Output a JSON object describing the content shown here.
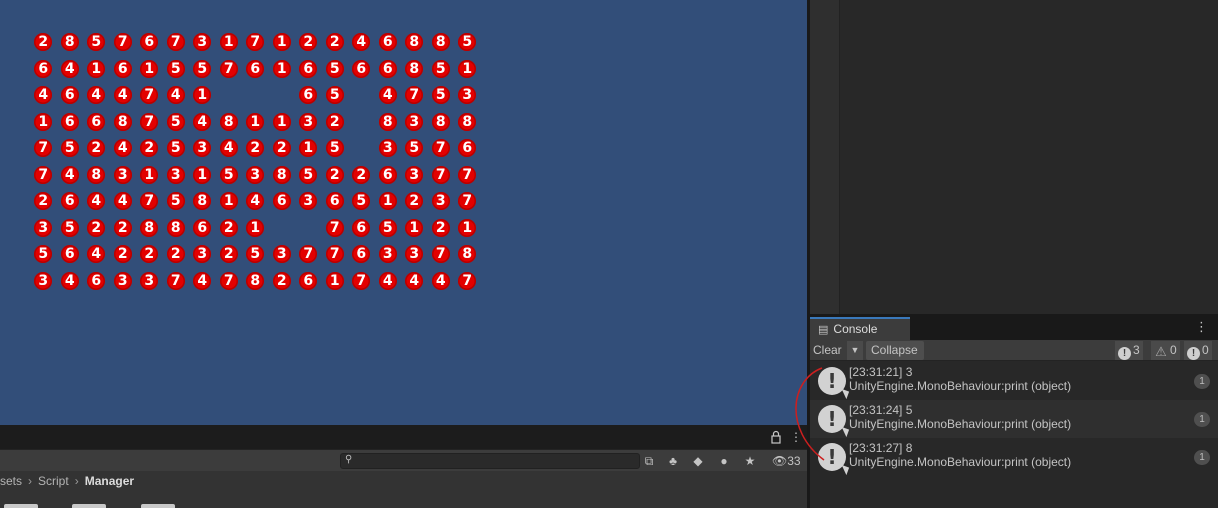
{
  "game": {
    "grid": [
      [
        "2",
        "8",
        "5",
        "7",
        "6",
        "7",
        "3",
        "1",
        "7",
        "1",
        "2",
        "2",
        "4",
        "6",
        "8",
        "8",
        "5"
      ],
      [
        "6",
        "4",
        "1",
        "6",
        "1",
        "5",
        "5",
        "7",
        "6",
        "1",
        "6",
        "5",
        "6",
        "6",
        "8",
        "5",
        "1"
      ],
      [
        "4",
        "6",
        "4",
        "4",
        "7",
        "4",
        "1",
        "",
        "",
        "",
        "6",
        "5",
        "",
        "4",
        "7",
        "5",
        "3"
      ],
      [
        "1",
        "6",
        "6",
        "8",
        "7",
        "5",
        "4",
        "8",
        "1",
        "1",
        "3",
        "2",
        "",
        "8",
        "3",
        "8",
        "8"
      ],
      [
        "7",
        "5",
        "2",
        "4",
        "2",
        "5",
        "3",
        "4",
        "2",
        "2",
        "1",
        "5",
        "",
        "3",
        "5",
        "7",
        "6"
      ],
      [
        "7",
        "4",
        "8",
        "3",
        "1",
        "3",
        "1",
        "5",
        "3",
        "8",
        "5",
        "2",
        "2",
        "6",
        "3",
        "7",
        "7"
      ],
      [
        "2",
        "6",
        "4",
        "4",
        "7",
        "5",
        "8",
        "1",
        "4",
        "6",
        "3",
        "6",
        "5",
        "1",
        "2",
        "3",
        "7"
      ],
      [
        "3",
        "5",
        "2",
        "2",
        "8",
        "8",
        "6",
        "2",
        "1",
        "",
        "",
        "7",
        "6",
        "5",
        "1",
        "2",
        "1"
      ],
      [
        "5",
        "6",
        "4",
        "2",
        "2",
        "2",
        "3",
        "2",
        "5",
        "3",
        "7",
        "7",
        "6",
        "3",
        "3",
        "7",
        "8"
      ],
      [
        "3",
        "4",
        "6",
        "3",
        "3",
        "7",
        "4",
        "7",
        "8",
        "2",
        "6",
        "1",
        "7",
        "4",
        "4",
        "4",
        "7"
      ]
    ]
  },
  "project": {
    "breadcrumb": [
      "sets",
      "Script",
      "Manager"
    ],
    "hidden_count": "33",
    "search_placeholder": ""
  },
  "console": {
    "tab_label": "Console",
    "toolbar": {
      "clear": "Clear",
      "collapse": "Collapse",
      "info_count": "3",
      "warn_count": "0",
      "error_count": "0"
    },
    "logs": [
      {
        "line1": "[23:31:21] 3",
        "line2": "UnityEngine.MonoBehaviour:print (object)",
        "count": "1"
      },
      {
        "line1": "[23:31:24] 5",
        "line2": "UnityEngine.MonoBehaviour:print (object)",
        "count": "1"
      },
      {
        "line1": "[23:31:27] 8",
        "line2": "UnityEngine.MonoBehaviour:print (object)",
        "count": "1"
      }
    ]
  },
  "icons": {
    "lock": "lock-icon",
    "kebab": "kebab-menu-icon",
    "search": "search-icon",
    "info": "info-icon",
    "warning": "warning-icon",
    "error": "error-icon"
  },
  "colors": {
    "game_bg": "#324e79",
    "ball": "#e30000",
    "tab_accent": "#3a79bb",
    "annotation": "#cc1f1f"
  }
}
